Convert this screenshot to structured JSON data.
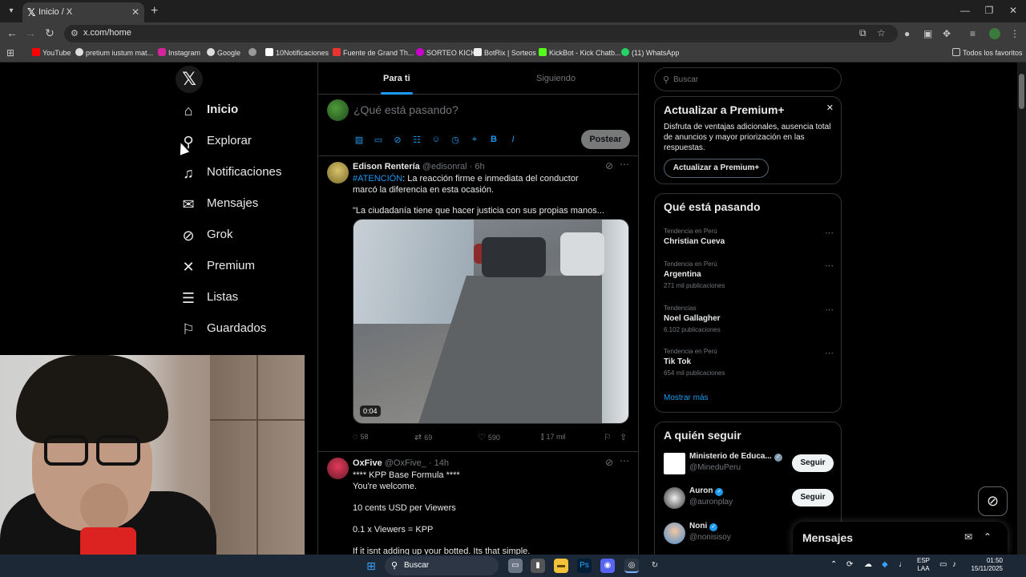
{
  "browser": {
    "tab_title": "Inicio / X",
    "url": "x.com/home",
    "bookmarks": [
      "YouTube",
      "pretium iustum mat...",
      "Instagram",
      "Google",
      "10Notificaciones",
      "Fuente de Grand Th...",
      "SORTEO KICK",
      "BotRix | Sorteos",
      "KickBot - Kick Chatb...",
      "(11) WhatsApp"
    ],
    "all_bookmarks": "Todos los favoritos"
  },
  "nav": {
    "items": [
      {
        "label": "Inicio",
        "icon": "home-icon"
      },
      {
        "label": "Explorar",
        "icon": "search-icon"
      },
      {
        "label": "Notificaciones",
        "icon": "bell-icon"
      },
      {
        "label": "Mensajes",
        "icon": "envelope-icon"
      },
      {
        "label": "Grok",
        "icon": "grok-icon"
      },
      {
        "label": "Premium",
        "icon": "x-logo-icon"
      },
      {
        "label": "Listas",
        "icon": "list-icon"
      },
      {
        "label": "Guardados",
        "icon": "bookmark-icon"
      }
    ]
  },
  "feed": {
    "tabs": [
      "Para ti",
      "Siguiendo"
    ],
    "compose_placeholder": "¿Qué está pasando?",
    "post_label": "Postear",
    "tweets": [
      {
        "name": "Edison Rentería",
        "handle": "@edisonral · 6h",
        "link_text": "#ATENCIÓN",
        "text1": ": La reacción firme e inmediata del conductor marcó la diferencia en esta ocasión.",
        "text2": "\"La ciudadanía tiene que hacer justicia con sus propias manos...",
        "video_time": "0:04",
        "replies": "58",
        "reposts": "69",
        "likes": "590",
        "views": "17 mil"
      },
      {
        "name": "OxFive",
        "handle": "@OxFive_ · 14h",
        "lines": [
          "****  KPP Base Formula ****",
          "You're welcome.",
          "",
          "10 cents USD per Viewers",
          "",
          "0.1 x Viewers = KPP",
          "",
          "If it isnt adding up your botted. Its that simple."
        ]
      }
    ]
  },
  "sidebar": {
    "search_placeholder": "Buscar",
    "premium": {
      "title": "Actualizar a Premium+",
      "text": "Disfruta de ventajas adicionales, ausencia total de anuncios y mayor priorización en las respuestas.",
      "button": "Actualizar a Premium+"
    },
    "trends": {
      "title": "Qué está pasando",
      "items": [
        {
          "meta": "Tendencia en Perú",
          "name": "Christian Cueva",
          "count": ""
        },
        {
          "meta": "Tendencia en Perú",
          "name": "Argentina",
          "count": "271 mil publicaciones"
        },
        {
          "meta": "Tendencias",
          "name": "Noel Gallagher",
          "count": "6.102 publicaciones"
        },
        {
          "meta": "Tendencia en Perú",
          "name": "Tik Tok",
          "count": "654 mil publicaciones"
        }
      ],
      "show_more": "Mostrar más"
    },
    "who_to_follow": {
      "title": "A quién seguir",
      "items": [
        {
          "name": "Ministerio de Educa...",
          "handle": "@MineduPeru",
          "button": "Seguir"
        },
        {
          "name": "Auron",
          "handle": "@auronplay",
          "button": "Seguir"
        },
        {
          "name": "Noni",
          "handle": "@nonisisoy",
          "button": ""
        }
      ]
    }
  },
  "messages_drawer": {
    "title": "Mensajes"
  },
  "taskbar": {
    "search_label": "Buscar",
    "lang_top": "ESP",
    "lang_bottom": "LAA",
    "time": "01:50",
    "date": "15/11/2025"
  },
  "colors": {
    "accent": "#1d9bf0",
    "background": "#000000",
    "border": "#2f3336",
    "muted": "#71767b"
  }
}
